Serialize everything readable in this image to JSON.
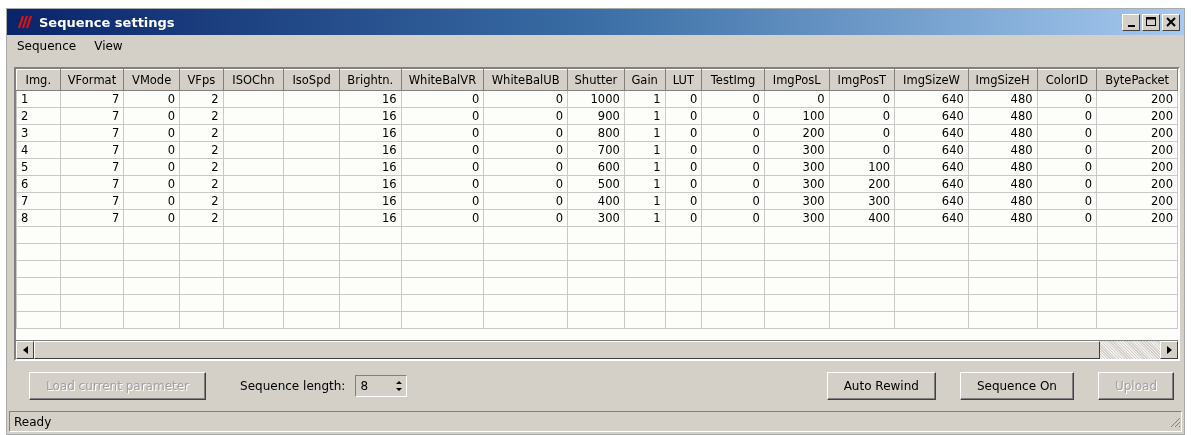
{
  "window": {
    "title": "Sequence settings"
  },
  "menu": [
    {
      "label": "Sequence"
    },
    {
      "label": "View"
    }
  ],
  "table": {
    "columns": [
      {
        "label": "Img.",
        "kind": "index"
      },
      {
        "label": "VFormat",
        "kind": "value"
      },
      {
        "label": "VMode",
        "kind": "value"
      },
      {
        "label": "VFps",
        "kind": "value"
      },
      {
        "label": "ISOChn"
      },
      {
        "label": "IsoSpd"
      },
      {
        "label": "Brightn.",
        "kind": "value"
      },
      {
        "label": "WhiteBalVR",
        "kind": "value"
      },
      {
        "label": "WhiteBalUB",
        "kind": "value"
      },
      {
        "label": "Shutter",
        "kind": "value"
      },
      {
        "label": "Gain",
        "kind": "value"
      },
      {
        "label": "LUT",
        "kind": "value"
      },
      {
        "label": "TestImg",
        "kind": "value"
      },
      {
        "label": "ImgPosL",
        "kind": "value"
      },
      {
        "label": "ImgPosT",
        "kind": "value"
      },
      {
        "label": "ImgSizeW",
        "kind": "value"
      },
      {
        "label": "ImgSizeH",
        "kind": "value"
      },
      {
        "label": "ColorID",
        "kind": "value"
      },
      {
        "label": "BytePacket",
        "kind": "value"
      }
    ],
    "rows": [
      [
        "1",
        "7",
        "0",
        "2",
        null,
        null,
        "16",
        "0",
        "0",
        "1000",
        "1",
        "0",
        "0",
        "0",
        "0",
        "640",
        "480",
        "0",
        "200"
      ],
      [
        "2",
        "7",
        "0",
        "2",
        null,
        null,
        "16",
        "0",
        "0",
        "900",
        "1",
        "0",
        "0",
        "100",
        "0",
        "640",
        "480",
        "0",
        "200"
      ],
      [
        "3",
        "7",
        "0",
        "2",
        null,
        null,
        "16",
        "0",
        "0",
        "800",
        "1",
        "0",
        "0",
        "200",
        "0",
        "640",
        "480",
        "0",
        "200"
      ],
      [
        "4",
        "7",
        "0",
        "2",
        null,
        null,
        "16",
        "0",
        "0",
        "700",
        "1",
        "0",
        "0",
        "300",
        "0",
        "640",
        "480",
        "0",
        "200"
      ],
      [
        "5",
        "7",
        "0",
        "2",
        null,
        null,
        "16",
        "0",
        "0",
        "600",
        "1",
        "0",
        "0",
        "300",
        "100",
        "640",
        "480",
        "0",
        "200"
      ],
      [
        "6",
        "7",
        "0",
        "2",
        null,
        null,
        "16",
        "0",
        "0",
        "500",
        "1",
        "0",
        "0",
        "300",
        "200",
        "640",
        "480",
        "0",
        "200"
      ],
      [
        "7",
        "7",
        "0",
        "2",
        null,
        null,
        "16",
        "0",
        "0",
        "400",
        "1",
        "0",
        "0",
        "300",
        "300",
        "640",
        "480",
        "0",
        "200"
      ],
      [
        "8",
        "7",
        "0",
        "2",
        null,
        null,
        "16",
        "0",
        "0",
        "300",
        "1",
        "0",
        "0",
        "300",
        "400",
        "640",
        "480",
        "0",
        "200"
      ]
    ]
  },
  "load_button": {
    "label": "Load current parameter",
    "disabled": true
  },
  "sequence_length": {
    "label": "Sequence length:",
    "value": "8"
  },
  "buttons": [
    {
      "label": "Auto Rewind",
      "disabled": false
    },
    {
      "label": "Sequence On",
      "disabled": false
    },
    {
      "label": "Upload",
      "disabled": true
    }
  ],
  "status_bar": {
    "text": "Ready"
  }
}
